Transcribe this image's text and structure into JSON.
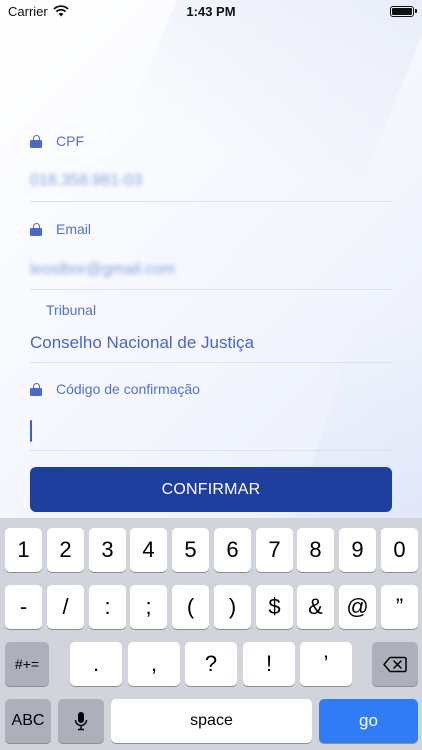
{
  "status_bar": {
    "carrier": "Carrier",
    "time": "1:43 PM",
    "battery_level": 1.0
  },
  "form": {
    "cpf": {
      "label": "CPF",
      "value": "018.358.981-03"
    },
    "email": {
      "label": "Email",
      "value": "leoslbor@gmail.com"
    },
    "tribunal": {
      "label": "Tribunal",
      "value": "Conselho Nacional de Justiça"
    },
    "codigo": {
      "label": "Código de confirmação",
      "value": ""
    },
    "confirm_label": "CONFIRMAR"
  },
  "keyboard": {
    "row1": [
      "1",
      "2",
      "3",
      "4",
      "5",
      "6",
      "7",
      "8",
      "9",
      "0"
    ],
    "row2": [
      "-",
      "/",
      ":",
      ";",
      "(",
      ")",
      "$",
      "&",
      "@",
      "”"
    ],
    "row3_symbols": "#+=",
    "row3": [
      ".",
      ",",
      "?",
      "!",
      "’"
    ],
    "abc": "ABC",
    "space": "space",
    "go": "go"
  },
  "colors": {
    "accent": "#1f3f9e",
    "label": "#5670c4",
    "go": "#2f7cf6",
    "keyboard_bg": "#d1d4da"
  }
}
